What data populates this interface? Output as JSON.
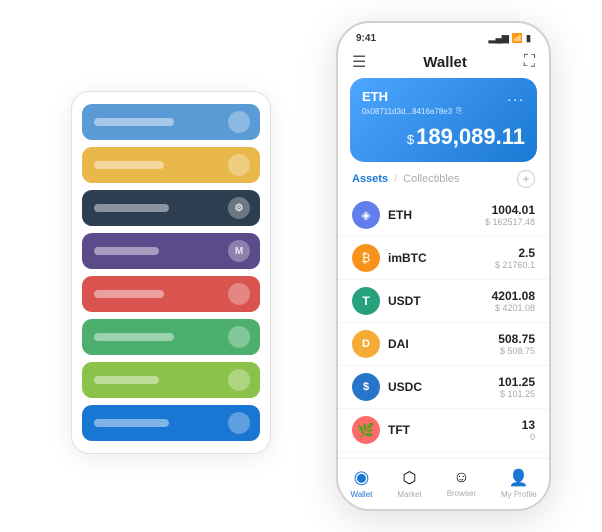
{
  "scene": {
    "background": "#ffffff"
  },
  "cardStack": {
    "rows": [
      {
        "color": "card-blue",
        "labelWidth": "80px",
        "iconText": ""
      },
      {
        "color": "card-yellow",
        "labelWidth": "70px",
        "iconText": ""
      },
      {
        "color": "card-dark",
        "labelWidth": "75px",
        "iconText": "⚙"
      },
      {
        "color": "card-purple",
        "labelWidth": "65px",
        "iconText": "M"
      },
      {
        "color": "card-red",
        "labelWidth": "70px",
        "iconText": ""
      },
      {
        "color": "card-green",
        "labelWidth": "80px",
        "iconText": ""
      },
      {
        "color": "card-lime",
        "labelWidth": "65px",
        "iconText": ""
      },
      {
        "color": "card-blue2",
        "labelWidth": "75px",
        "iconText": ""
      }
    ]
  },
  "phone": {
    "statusBar": {
      "time": "9:41",
      "icons": [
        "signal",
        "wifi",
        "battery"
      ]
    },
    "topNav": {
      "menuIcon": "☰",
      "title": "Wallet",
      "expandIcon": "⛶"
    },
    "ethCard": {
      "label": "ETH",
      "dotsLabel": "...",
      "address": "0x08711d3d...8416a78e3",
      "copyIcon": "⎘",
      "amount": "189,089.11",
      "dollarSign": "$"
    },
    "assetsSection": {
      "tabActive": "Assets",
      "separator": "/",
      "tabInactive": "Collectibles",
      "addButtonLabel": "+"
    },
    "assets": [
      {
        "name": "ETH",
        "amount": "1004.01",
        "usd": "$ 162517.48",
        "iconColor": "#627eea",
        "iconText": "◈",
        "iconClass": "asset-icon-eth"
      },
      {
        "name": "imBTC",
        "amount": "2.5",
        "usd": "$ 21760.1",
        "iconColor": "#f7931a",
        "iconText": "₿",
        "iconClass": "asset-icon-imbtc"
      },
      {
        "name": "USDT",
        "amount": "4201.08",
        "usd": "$ 4201.08",
        "iconColor": "#26a17b",
        "iconText": "₮",
        "iconClass": "asset-icon-usdt"
      },
      {
        "name": "DAI",
        "amount": "508.75",
        "usd": "$ 508.75",
        "iconColor": "#f5ac37",
        "iconText": "◈",
        "iconClass": "asset-icon-dai"
      },
      {
        "name": "USDC",
        "amount": "101.25",
        "usd": "$ 101.25",
        "iconColor": "#2775ca",
        "iconText": "$",
        "iconClass": "asset-icon-usdc"
      },
      {
        "name": "TFT",
        "amount": "13",
        "usd": "0",
        "iconColor": "#ff6b6b",
        "iconText": "🌿",
        "iconClass": "asset-icon-tft"
      }
    ],
    "bottomNav": [
      {
        "id": "wallet",
        "label": "Wallet",
        "icon": "◉",
        "active": true
      },
      {
        "id": "market",
        "label": "Market",
        "icon": "⬡",
        "active": false
      },
      {
        "id": "browser",
        "label": "Browser",
        "icon": "☺",
        "active": false
      },
      {
        "id": "my-profile",
        "label": "My Profile",
        "icon": "👤",
        "active": false
      }
    ]
  }
}
